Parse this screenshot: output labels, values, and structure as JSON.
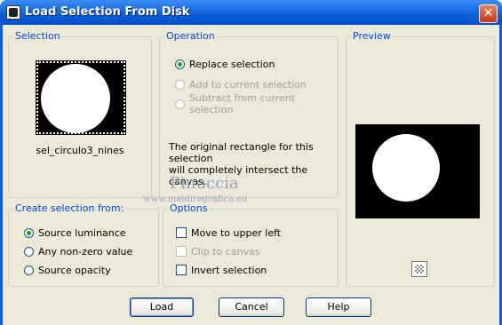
{
  "window": {
    "title": "Load Selection From Disk",
    "close_label": "✕"
  },
  "selection_group": {
    "label": "Selection",
    "file_name": "sel_circulo3_nines"
  },
  "operation_group": {
    "label": "Operation",
    "options": [
      {
        "label": "Replace selection",
        "checked": true,
        "disabled": false
      },
      {
        "label": "Add to current selection",
        "checked": false,
        "disabled": true
      },
      {
        "label": "Subtract from current selection",
        "checked": false,
        "disabled": true
      }
    ],
    "info_line1": "The original rectangle for this selection",
    "info_line2": "will completely intersect the canvas."
  },
  "preview_group": {
    "label": "Preview"
  },
  "create_group": {
    "label": "Create selection from:",
    "options": [
      {
        "label": "Source luminance",
        "checked": true
      },
      {
        "label": "Any non-zero value",
        "checked": false
      },
      {
        "label": "Source opacity",
        "checked": false
      }
    ]
  },
  "options_group": {
    "label": "Options",
    "items": [
      {
        "label": "Move to upper left",
        "checked": false,
        "disabled": false
      },
      {
        "label": "Clip to canvas",
        "checked": false,
        "disabled": true
      },
      {
        "label": "Invert selection",
        "checked": false,
        "disabled": false
      }
    ]
  },
  "buttons": {
    "load": "Load",
    "cancel": "Cancel",
    "help": "Help"
  },
  "watermark": {
    "line1": "Pinuccia",
    "line2": "www.maidiregrafica.eu"
  }
}
